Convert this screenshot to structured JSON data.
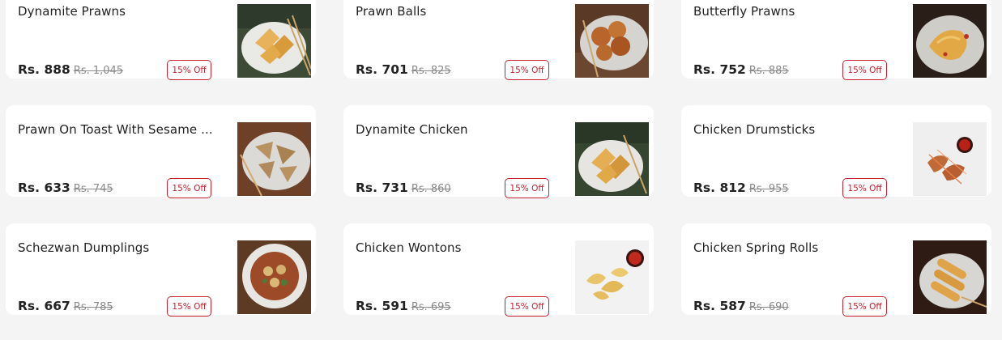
{
  "items": [
    {
      "name": "Dynamite Prawns",
      "price": "Rs. 888",
      "mrp": "Rs. 1,045",
      "discount": "15% Off",
      "image": "dynamite-prawns-dish"
    },
    {
      "name": "Prawn Balls",
      "price": "Rs. 701",
      "mrp": "Rs. 825",
      "discount": "15% Off",
      "image": "prawn-balls-dish"
    },
    {
      "name": "Butterfly Prawns",
      "price": "Rs. 752",
      "mrp": "Rs. 885",
      "discount": "15% Off",
      "image": "butterfly-prawns-dish"
    },
    {
      "name": "Prawn On Toast With Sesame ...",
      "price": "Rs. 633",
      "mrp": "Rs. 745",
      "discount": "15% Off",
      "image": "prawn-toast-dish"
    },
    {
      "name": "Dynamite Chicken",
      "price": "Rs. 731",
      "mrp": "Rs. 860",
      "discount": "15% Off",
      "image": "dynamite-chicken-dish"
    },
    {
      "name": "Chicken Drumsticks",
      "price": "Rs. 812",
      "mrp": "Rs. 955",
      "discount": "15% Off",
      "image": "chicken-drumsticks-dish"
    },
    {
      "name": "Schezwan Dumplings",
      "price": "Rs. 667",
      "mrp": "Rs. 785",
      "discount": "15% Off",
      "image": "schezwan-dumplings-dish"
    },
    {
      "name": "Chicken Wontons",
      "price": "Rs. 591",
      "mrp": "Rs. 695",
      "discount": "15% Off",
      "image": "chicken-wontons-dish"
    },
    {
      "name": "Chicken Spring Rolls",
      "price": "Rs. 587",
      "mrp": "Rs. 690",
      "discount": "15% Off",
      "image": "chicken-spring-rolls-dish"
    }
  ],
  "colors": {
    "page_bg": "#f4f4f4",
    "card_bg": "#ffffff",
    "badge_accent": "#c8212f",
    "text_primary": "#222222",
    "text_muted": "#8a8a8a"
  }
}
